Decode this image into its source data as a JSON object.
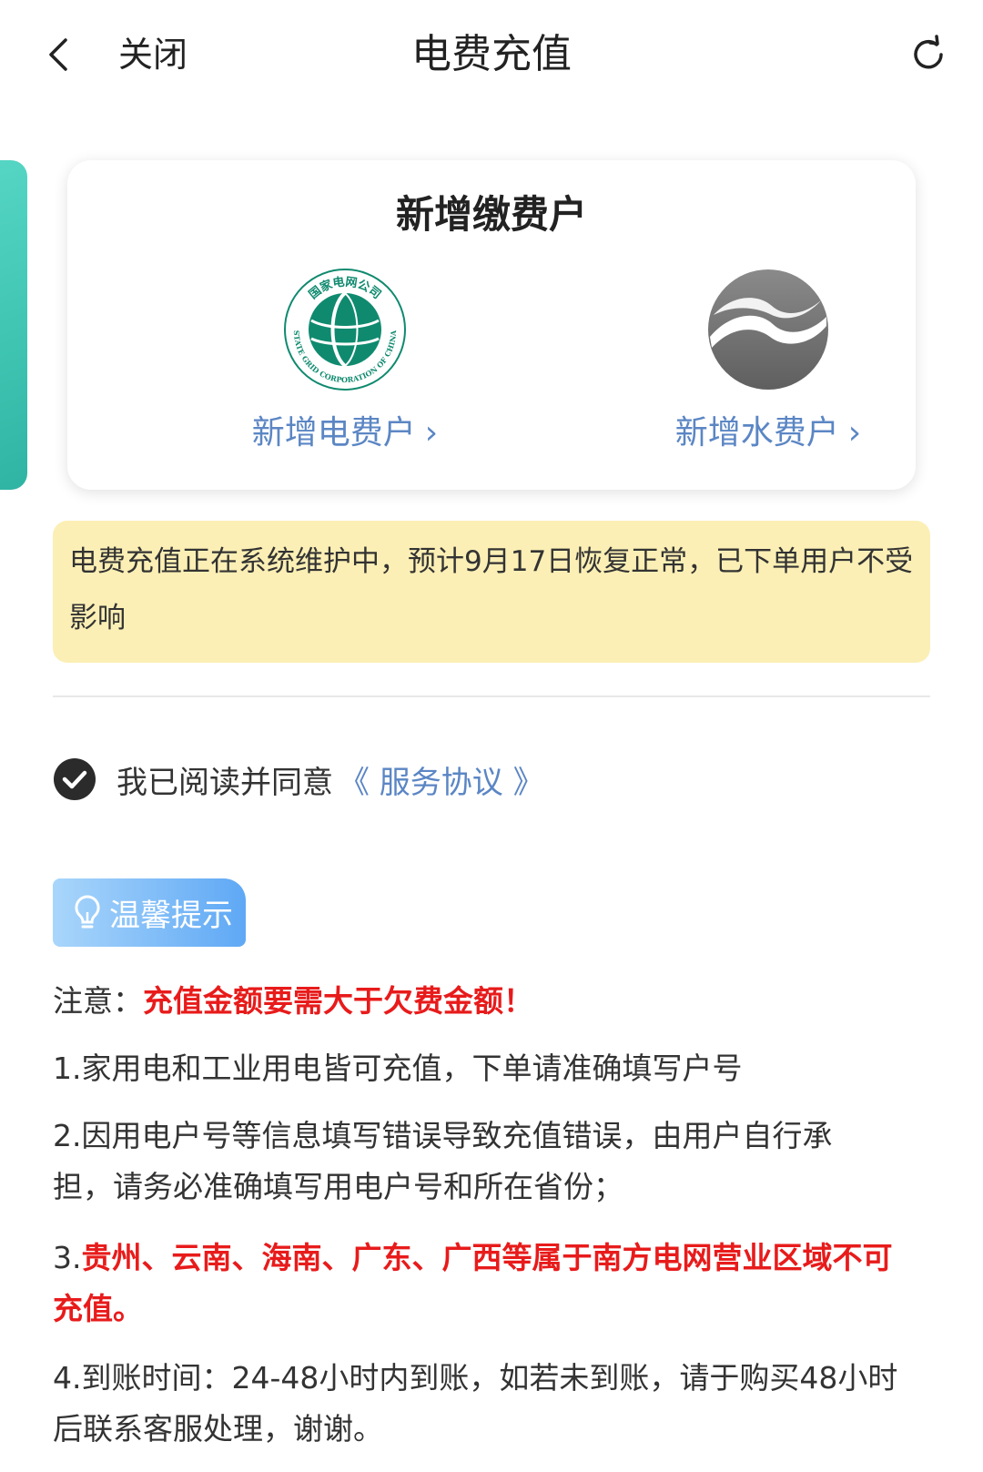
{
  "header": {
    "close_label": "关闭",
    "title": "电费充值"
  },
  "card": {
    "title": "新增缴费户",
    "electric": {
      "link": "新增电费户",
      "logo_text_top": "国家电网公司",
      "logo_text_bottom": "STATE GRID CORPORATION OF CHINA"
    },
    "water": {
      "link": "新增水费户"
    },
    "chevron": "›"
  },
  "notice": {
    "text": "电费充值正在系统维护中，预计9月17日恢复正常，已下单用户不受影响"
  },
  "agreement": {
    "text": "我已阅读并同意",
    "link": "《 服务协议 》"
  },
  "tips": {
    "badge": "温馨提示",
    "note_prefix": "注意：",
    "note_highlight": "充值金额要需大于欠费金额！",
    "item1": "1.家用电和工业用电皆可充值，下单请准确填写户号",
    "item2": "2.因用电户号等信息填写错误导致充值错误，由用户自行承担，请务必准确填写用电户号和所在省份；",
    "item3_prefix": "3.",
    "item3_highlight": "贵州、云南、海南、广东、广西等属于南方电网营业区域不可充值。",
    "item4": "4.到账时间：24-48小时内到账，如若未到账，请于购买48小时后联系客服处理，谢谢。"
  },
  "colors": {
    "link_blue": "#5b86c4",
    "notice_bg": "#fbefb5",
    "warning_red": "#e81b1b",
    "state_grid_green": "#0f8a6f",
    "tip_badge_blue": "#5fa8f5"
  }
}
